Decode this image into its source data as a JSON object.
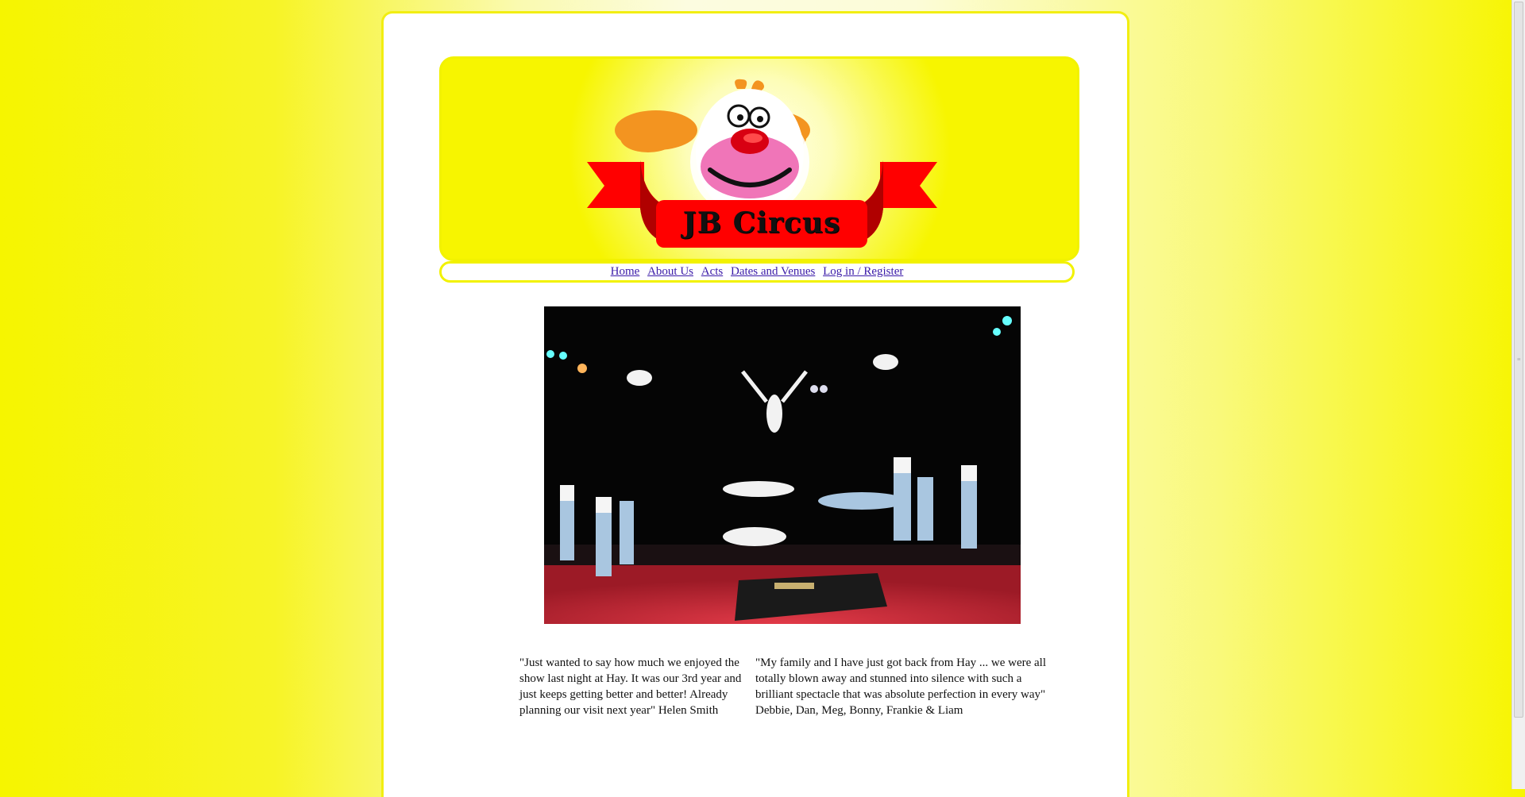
{
  "header": {
    "logo_text": "JB Circus",
    "logo_icon": "clown-face-icon"
  },
  "nav": {
    "items": [
      {
        "label": "Home"
      },
      {
        "label": "About Us"
      },
      {
        "label": "Acts"
      },
      {
        "label": "Dates and Venues"
      },
      {
        "label": "Log in / Register"
      }
    ]
  },
  "hero": {
    "image": "acrobats-performance-photo"
  },
  "testimonials": [
    {
      "text": "\"Just wanted to say how much we enjoyed the show last night at Hay. It was our 3rd year and just keeps getting better and better! Already planning our visit next year\" Helen Smith"
    },
    {
      "text": "\"My family and I have just got back from Hay ... we were all totally blown away and stunned into silence with such a brilliant spectacle that was absolute perfection in every way\" Debbie, Dan, Meg, Bonny, Frankie & Liam"
    }
  ],
  "colors": {
    "background": "#f6f500",
    "link": "#3a1aa8",
    "banner_ribbon": "#ff0000",
    "clown_hair": "#f39420",
    "clown_mouth": "#f075b8"
  }
}
